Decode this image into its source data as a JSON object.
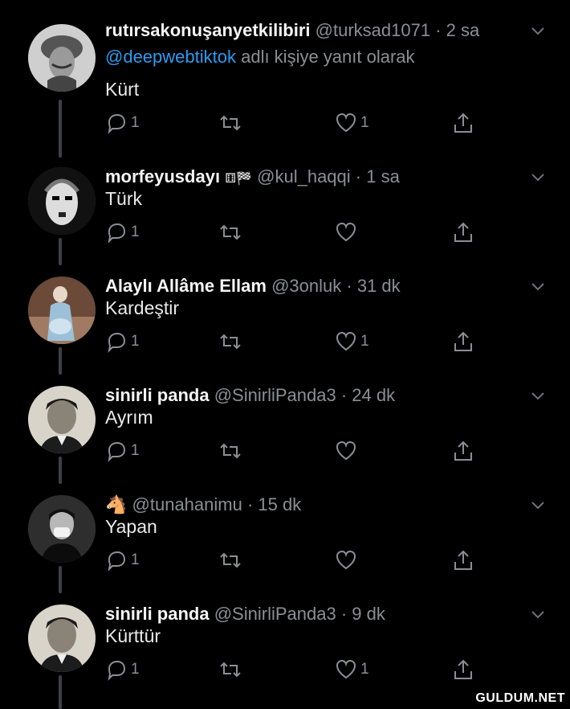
{
  "tweets": [
    {
      "name": "rutırsakonuşanyetkilibiri",
      "handle": "@turksad1071",
      "time": "2 sa",
      "reply_prefix": "",
      "reply_mention": "@deepwebtiktok",
      "reply_suffix": " adlı kişiye yanıt olarak",
      "text": "Kürt",
      "reply_count": "1",
      "retweet_count": "",
      "like_count": "1"
    },
    {
      "name": "morfeyusdayı",
      "name_emoji": "⚅🏁",
      "handle": "@kul_haqqi",
      "time": "1 sa",
      "text": "Türk",
      "reply_count": "1",
      "retweet_count": "",
      "like_count": ""
    },
    {
      "name": "Alaylı Allâme Ellam",
      "handle": "@3onluk",
      "time": "31 dk",
      "text": "Kardeştir",
      "reply_count": "1",
      "retweet_count": "",
      "like_count": "1"
    },
    {
      "name": "sinirli panda",
      "handle": "@SinirliPanda3",
      "time": "24 dk",
      "text": "Ayrım",
      "reply_count": "1",
      "retweet_count": "",
      "like_count": ""
    },
    {
      "name": "🐴",
      "handle": "@tunahanimu",
      "time": "15 dk",
      "text": "Yapan",
      "reply_count": "1",
      "retweet_count": "",
      "like_count": ""
    },
    {
      "name": "sinirli panda",
      "handle": "@SinirliPanda3",
      "time": "9 dk",
      "text": "Kürttür",
      "reply_count": "1",
      "retweet_count": "",
      "like_count": "1"
    }
  ],
  "separator": "·",
  "icons": {
    "reply": "reply-icon",
    "retweet": "retweet-icon",
    "like": "heart-icon",
    "share": "share-icon",
    "menu": "chevron-down-icon"
  },
  "colors": {
    "background": "#000000",
    "accent": "#2c9cef",
    "muted": "#8b8f94"
  },
  "watermark": "GULDUM.NET"
}
